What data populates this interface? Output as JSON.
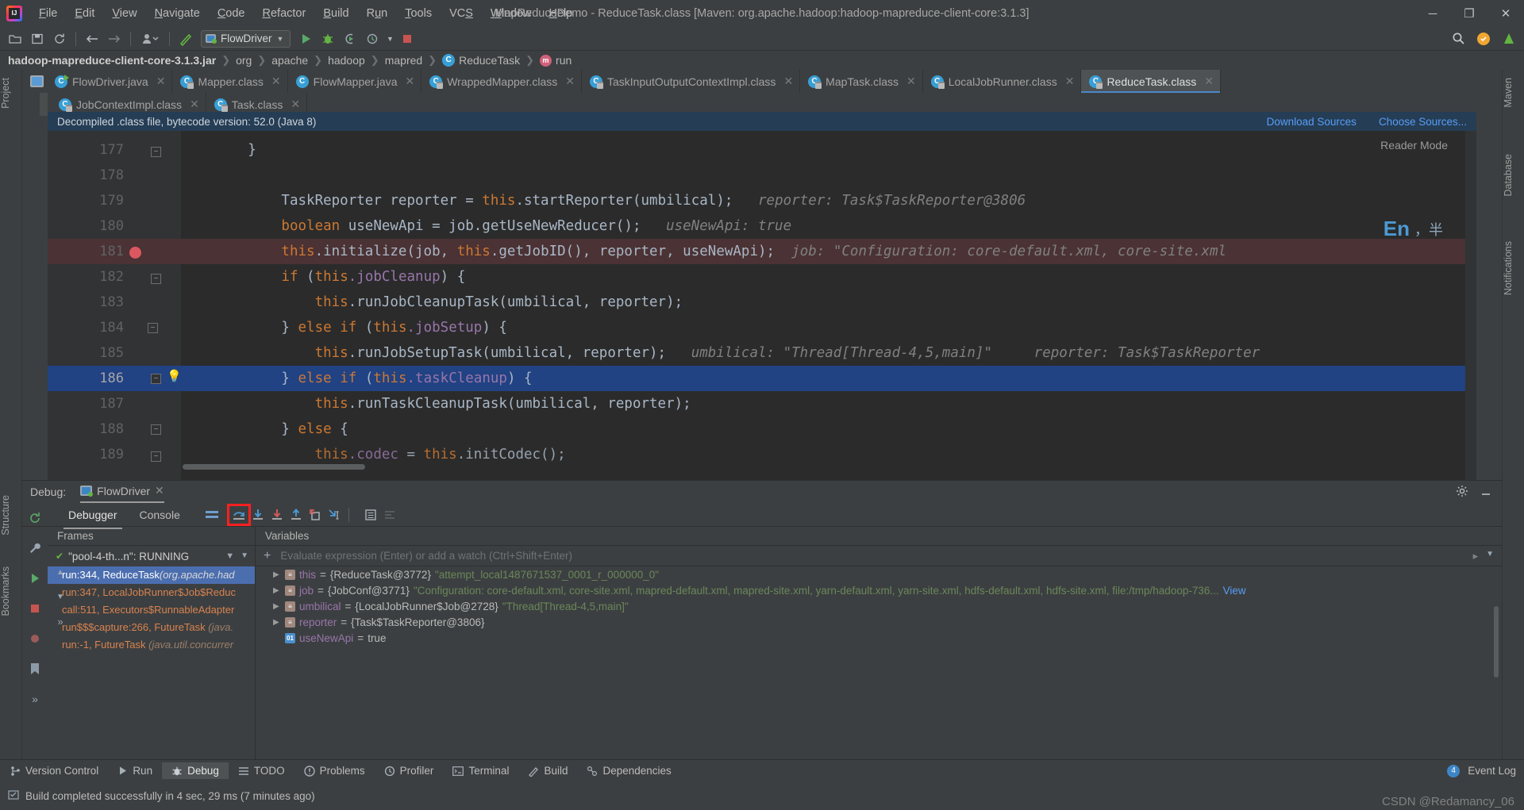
{
  "window": {
    "title": "MapReduceDemo - ReduceTask.class [Maven: org.apache.hadoop:hadoop-mapreduce-client-core:3.1.3]",
    "minimize": "─",
    "maximize": "❐",
    "close": "✕"
  },
  "menu": [
    "File",
    "Edit",
    "View",
    "Navigate",
    "Code",
    "Refactor",
    "Build",
    "Run",
    "Tools",
    "VCS",
    "Window",
    "Help"
  ],
  "toolbar": {
    "run_config": "FlowDriver",
    "icons": [
      "open-folder-icon",
      "save-icon",
      "sync-icon",
      "back-icon",
      "forward-icon",
      "user-icon",
      "build-icon"
    ],
    "run_icon": "run-icon",
    "debug_icon": "debug-icon",
    "coverage_icon": "run-with-coverage-icon",
    "profile_icon": "profiler-icon",
    "stop_icon": "stop-icon",
    "search_icon": "search-icon"
  },
  "breadcrumb": [
    "hadoop-mapreduce-client-core-3.1.3.jar",
    "org",
    "apache",
    "hadoop",
    "mapred",
    "ReduceTask",
    "run"
  ],
  "editor_tabs_row1": [
    {
      "label": "FlowDriver.java",
      "icon": "java-run-icon",
      "active": false
    },
    {
      "label": "Mapper.class",
      "icon": "class-locked-icon",
      "active": false
    },
    {
      "label": "FlowMapper.java",
      "icon": "java-icon",
      "active": false
    },
    {
      "label": "WrappedMapper.class",
      "icon": "class-locked-icon",
      "active": false
    },
    {
      "label": "TaskInputOutputContextImpl.class",
      "icon": "class-locked-icon",
      "active": false
    },
    {
      "label": "MapTask.class",
      "icon": "class-locked-icon",
      "active": false
    },
    {
      "label": "LocalJobRunner.class",
      "icon": "class-locked-icon",
      "active": false
    },
    {
      "label": "ReduceTask.class",
      "icon": "class-locked-icon",
      "active": true
    }
  ],
  "editor_tabs_row2": [
    {
      "label": "JobContextImpl.class",
      "icon": "class-locked-icon",
      "active": false
    },
    {
      "label": "Task.class",
      "icon": "class-locked-icon",
      "active": false
    }
  ],
  "notification": {
    "text": "Decompiled .class file, bytecode version: 52.0 (Java 8)",
    "link_download": "Download Sources",
    "link_choose": "Choose Sources..."
  },
  "editor": {
    "reader_mode": "Reader Mode",
    "ime_main": "En",
    "ime_sub": "，半",
    "position": "186:",
    "lines": [
      {
        "num": "177",
        "indent": 3,
        "tokens": [
          {
            "t": "}",
            "c": "ident"
          }
        ]
      },
      {
        "num": "178",
        "indent": 0,
        "tokens": []
      },
      {
        "num": "179",
        "indent": 6,
        "tokens": [
          {
            "t": "TaskReporter reporter = ",
            "c": "ident"
          },
          {
            "t": "this",
            "c": "kw"
          },
          {
            "t": ".startReporter(umbilical);",
            "c": "ident"
          },
          {
            "t": "   reporter: Task$TaskReporter@3806",
            "c": "hint"
          }
        ]
      },
      {
        "num": "180",
        "indent": 6,
        "tokens": [
          {
            "t": "boolean",
            "c": "kw"
          },
          {
            "t": " useNewApi = job.getUseNewReducer();",
            "c": "ident"
          },
          {
            "t": "   useNewApi: true",
            "c": "hint"
          }
        ]
      },
      {
        "num": "181",
        "indent": 6,
        "tokens": [
          {
            "t": "this",
            "c": "kw"
          },
          {
            "t": ".initialize(job, ",
            "c": "ident"
          },
          {
            "t": "this",
            "c": "kw"
          },
          {
            "t": ".getJobID(), reporter, useNewApi);",
            "c": "ident"
          },
          {
            "t": "   job: \"Configuration: core-default.xml, core-site.xml",
            "c": "hint"
          }
        ]
      },
      {
        "num": "182",
        "indent": 6,
        "tokens": [
          {
            "t": "if",
            "c": "kw"
          },
          {
            "t": " (",
            "c": "ident"
          },
          {
            "t": "this",
            "c": "kw"
          },
          {
            "t": ".jobCleanup) {",
            "c": "fld"
          }
        ]
      },
      {
        "num": "183",
        "indent": 8,
        "tokens": [
          {
            "t": "this",
            "c": "kw"
          },
          {
            "t": ".runJobCleanupTask(umbilical, reporter);",
            "c": "ident"
          }
        ]
      },
      {
        "num": "184",
        "indent": 6,
        "tokens": [
          {
            "t": "} ",
            "c": "ident"
          },
          {
            "t": "else if",
            "c": "kw"
          },
          {
            "t": " (",
            "c": "ident"
          },
          {
            "t": "this",
            "c": "kw"
          },
          {
            "t": ".jobSetup) {",
            "c": "fld"
          }
        ]
      },
      {
        "num": "185",
        "indent": 8,
        "tokens": [
          {
            "t": "this",
            "c": "kw"
          },
          {
            "t": ".runJobSetupTask(umbilical, reporter);",
            "c": "ident"
          },
          {
            "t": "   umbilical: \"Thread[Thread-4,5,main]\"    reporter: Task$TaskReporter",
            "c": "hint"
          }
        ]
      },
      {
        "num": "186",
        "indent": 6,
        "tokens": [
          {
            "t": "} ",
            "c": "ident"
          },
          {
            "t": "else if",
            "c": "kw"
          },
          {
            "t": " (",
            "c": "ident"
          },
          {
            "t": "this",
            "c": "kw"
          },
          {
            "t": ".taskCleanup) {",
            "c": "fld"
          }
        ]
      },
      {
        "num": "187",
        "indent": 8,
        "tokens": [
          {
            "t": "this",
            "c": "kw"
          },
          {
            "t": ".runTaskCleanupTask(umbilical, reporter);",
            "c": "ident"
          }
        ]
      },
      {
        "num": "188",
        "indent": 6,
        "tokens": [
          {
            "t": "} ",
            "c": "ident"
          },
          {
            "t": "else",
            "c": "kw"
          },
          {
            "t": " {",
            "c": "ident"
          }
        ]
      },
      {
        "num": "189",
        "indent": 8,
        "tokens": [
          {
            "t": "this",
            "c": "kw"
          },
          {
            "t": ".codec = ",
            "c": "fld"
          },
          {
            "t": "this",
            "c": "kw"
          },
          {
            "t": ".initCodec();",
            "c": "ident"
          }
        ]
      }
    ]
  },
  "debug": {
    "label": "Debug:",
    "session": "FlowDriver",
    "tabs": [
      "Debugger",
      "Console"
    ],
    "active_tab": "Debugger",
    "toolbar_icons": [
      "layout-icon",
      "step-over-icon",
      "step-into-icon",
      "force-step-into-icon",
      "step-out-icon",
      "drop-frame-icon",
      "run-to-cursor-icon",
      "evaluate-icon",
      "settings-list-icon"
    ],
    "settings_icon": "gear-icon",
    "minimize_icon": "minimize-icon",
    "frames_title": "Frames",
    "thread": "\"pool-4-th...n\": RUNNING",
    "frames": [
      {
        "method": "run:344, ReduceTask",
        "pkg": "(org.apache.had",
        "selected": true
      },
      {
        "method": "run:347, LocalJobRunner$Job$Reduc",
        "pkg": "",
        "selected": false
      },
      {
        "method": "call:511, Executors$RunnableAdapter",
        "pkg": "",
        "selected": false
      },
      {
        "method": "run$$$capture:266, FutureTask ",
        "pkg": "(java.",
        "selected": false
      },
      {
        "method": "run:-1, FutureTask ",
        "pkg": "(java.util.concurrer",
        "selected": false
      }
    ],
    "variables_title": "Variables",
    "watch_placeholder": "Evaluate expression (Enter) or add a watch (Ctrl+Shift+Enter)",
    "variables": [
      {
        "name": "this",
        "eq": " = ",
        "value": "{ReduceTask@3772} ",
        "str": "\"attempt_local1487671537_0001_r_000000_0\"",
        "kind": "obj",
        "expandable": true
      },
      {
        "name": "job",
        "eq": " = ",
        "value": "{JobConf@3771} ",
        "str": "\"Configuration: core-default.xml, core-site.xml, mapred-default.xml, mapred-site.xml, yarn-default.xml, yarn-site.xml, hdfs-default.xml, hdfs-site.xml, file:/tmp/hadoop-736...",
        "link": "View",
        "kind": "obj",
        "expandable": true
      },
      {
        "name": "umbilical",
        "eq": " = ",
        "value": "{LocalJobRunner$Job@2728} ",
        "str": "\"Thread[Thread-4,5,main]\"",
        "kind": "obj",
        "expandable": true
      },
      {
        "name": "reporter",
        "eq": " = ",
        "value": "{Task$TaskReporter@3806}",
        "str": "",
        "kind": "obj",
        "expandable": true
      },
      {
        "name": "useNewApi",
        "eq": " = ",
        "value": "true",
        "str": "",
        "kind": "prim",
        "expandable": false
      }
    ]
  },
  "toolwindows": [
    {
      "label": "Version Control",
      "icon": "branch-icon",
      "active": false
    },
    {
      "label": "Run",
      "icon": "run-icon",
      "active": false
    },
    {
      "label": "Debug",
      "icon": "debug-icon",
      "active": true
    },
    {
      "label": "TODO",
      "icon": "todo-icon",
      "active": false
    },
    {
      "label": "Problems",
      "icon": "problems-icon",
      "active": false
    },
    {
      "label": "Profiler",
      "icon": "profiler-icon",
      "active": false
    },
    {
      "label": "Terminal",
      "icon": "terminal-icon",
      "active": false
    },
    {
      "label": "Build",
      "icon": "build-icon",
      "active": false
    },
    {
      "label": "Dependencies",
      "icon": "dependencies-icon",
      "active": false
    }
  ],
  "event_log": {
    "label": "Event Log",
    "count": "4"
  },
  "statusbar": {
    "message": "Build completed successfully in 4 sec, 29 ms (7 minutes ago)",
    "watermark": "CSDN @Redamancy_06"
  },
  "left_stripes": [
    "Project",
    "Structure",
    "Bookmarks"
  ],
  "right_stripes": [
    "Maven",
    "Database",
    "Notifications"
  ],
  "colors": {
    "accent": "#4a88c7",
    "selection": "#214283",
    "error_line": "#4b3234",
    "link": "#589df6",
    "notif_bg": "#253d55",
    "highlight_box": "#ff2020"
  }
}
